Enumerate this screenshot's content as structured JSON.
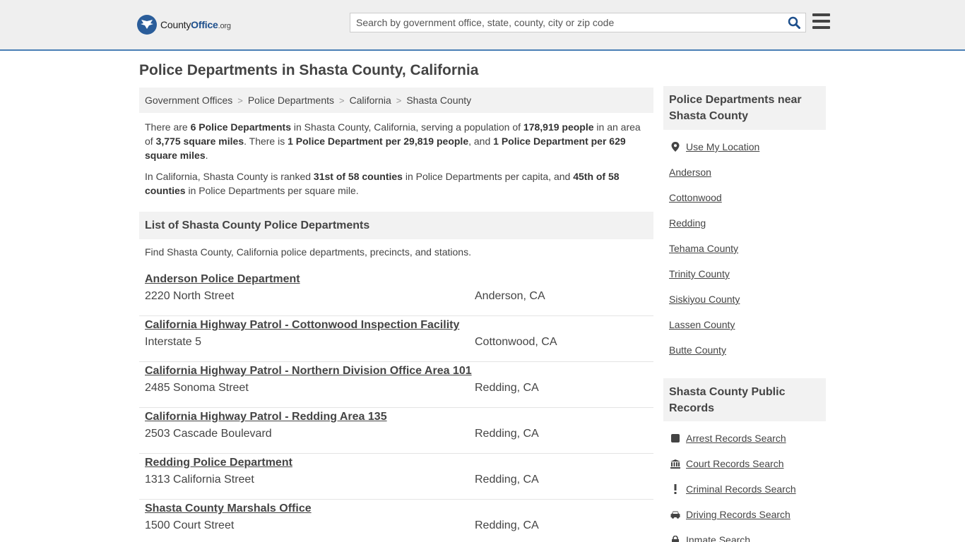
{
  "header": {
    "logo_prefix": "County",
    "logo_bold": "Office",
    "logo_tld": ".org",
    "search_placeholder": "Search by government office, state, county, city or zip code"
  },
  "page_title": "Police Departments in Shasta County, California",
  "breadcrumb": [
    "Government Offices",
    "Police Departments",
    "California",
    "Shasta County"
  ],
  "intro": {
    "p1": [
      {
        "t": "There are ",
        "b": false
      },
      {
        "t": "6 Police Departments",
        "b": true
      },
      {
        "t": " in Shasta County, California, serving a population of ",
        "b": false
      },
      {
        "t": "178,919 people",
        "b": true
      },
      {
        "t": " in an area of ",
        "b": false
      },
      {
        "t": "3,775 square miles",
        "b": true
      },
      {
        "t": ". There is ",
        "b": false
      },
      {
        "t": "1 Police Department per 29,819 people",
        "b": true
      },
      {
        "t": ", and ",
        "b": false
      },
      {
        "t": "1 Police Department per 629 square miles",
        "b": true
      },
      {
        "t": ".",
        "b": false
      }
    ],
    "p2": [
      {
        "t": "In California, Shasta County is ranked ",
        "b": false
      },
      {
        "t": "31st of 58 counties",
        "b": true
      },
      {
        "t": " in Police Departments per capita, and ",
        "b": false
      },
      {
        "t": "45th of 58 counties",
        "b": true
      },
      {
        "t": " in Police Departments per square mile.",
        "b": false
      }
    ]
  },
  "list": {
    "title": "List of Shasta County Police Departments",
    "description": "Find Shasta County, California police departments, precincts, and stations.",
    "entries": [
      {
        "name": "Anderson Police Department",
        "address": "2220 North Street",
        "city": "Anderson, CA"
      },
      {
        "name": "California Highway Patrol - Cottonwood Inspection Facility",
        "address": "Interstate 5",
        "city": "Cottonwood, CA"
      },
      {
        "name": "California Highway Patrol - Northern Division Office Area 101",
        "address": "2485 Sonoma Street",
        "city": "Redding, CA"
      },
      {
        "name": "California Highway Patrol - Redding Area 135",
        "address": "2503 Cascade Boulevard",
        "city": "Redding, CA"
      },
      {
        "name": "Redding Police Department",
        "address": "1313 California Street",
        "city": "Redding, CA"
      },
      {
        "name": "Shasta County Marshals Office",
        "address": "1500 Court Street",
        "city": "Redding, CA"
      }
    ]
  },
  "sidebar": {
    "nearby_title": "Police Departments near Shasta County",
    "nearby_links": [
      {
        "label": "Use My Location",
        "icon": "map-marker-icon"
      },
      {
        "label": "Anderson"
      },
      {
        "label": "Cottonwood"
      },
      {
        "label": "Redding"
      },
      {
        "label": "Tehama County"
      },
      {
        "label": "Trinity County"
      },
      {
        "label": "Siskiyou County"
      },
      {
        "label": "Lassen County"
      },
      {
        "label": "Butte County"
      }
    ],
    "records_title": "Shasta County Public Records",
    "records_links": [
      {
        "label": "Arrest Records Search",
        "icon": "square-icon"
      },
      {
        "label": "Court Records Search",
        "icon": "courthouse-icon"
      },
      {
        "label": "Criminal Records Search",
        "icon": "exclamation-icon"
      },
      {
        "label": "Driving Records Search",
        "icon": "car-icon"
      },
      {
        "label": "Inmate Search",
        "icon": "lock-icon"
      }
    ]
  }
}
